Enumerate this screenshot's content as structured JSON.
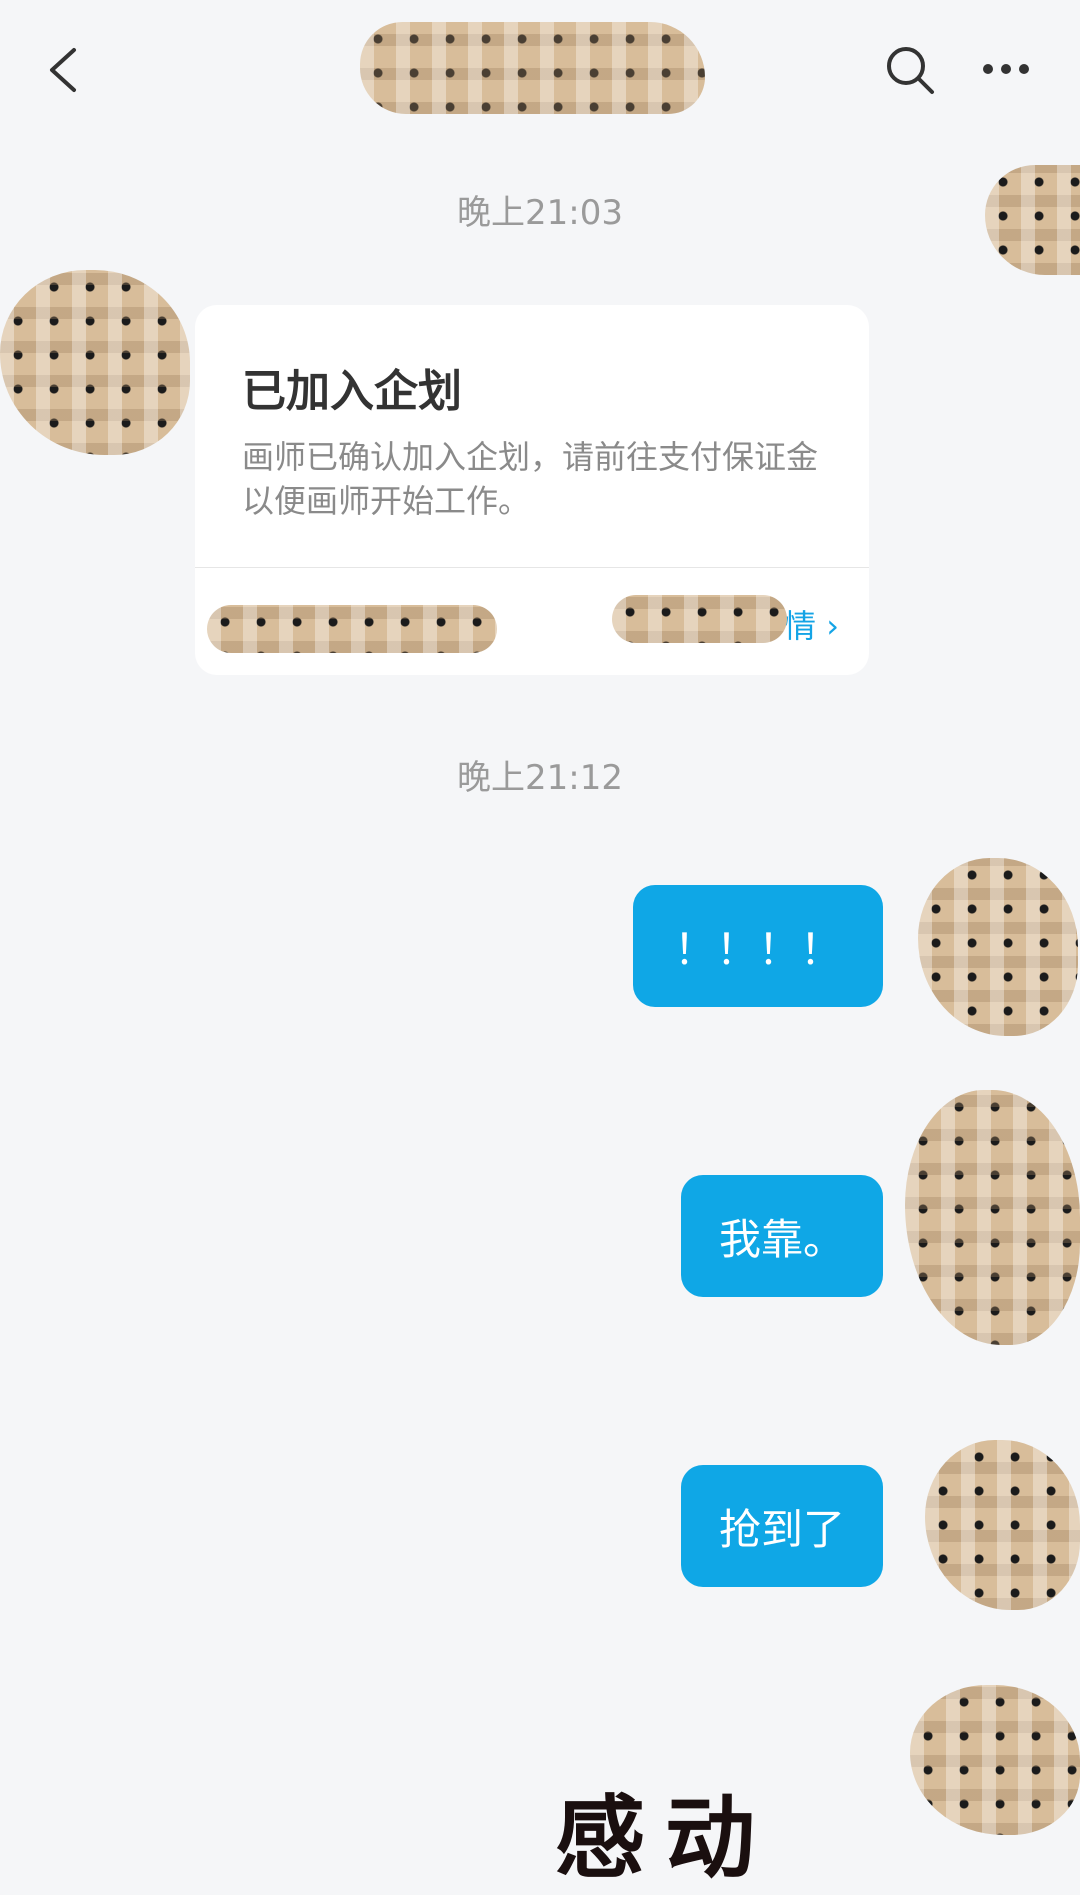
{
  "header": {
    "back_icon": "chevron-left-icon",
    "search_icon": "search-icon",
    "more_icon": "more-horizontal-icon"
  },
  "messages": {
    "time1": "晚上21:03",
    "card": {
      "title": "已加入企划",
      "description": "画师已确认加入企划，请前往支付保证金以便画师开始工作。",
      "link_label": "详情 ›"
    },
    "time2": "晚上21:12",
    "bubble1": "！！！！",
    "bubble2": "我靠。",
    "bubble3": "抢到了",
    "sticker_text": "感动"
  },
  "colors": {
    "bubble": "#0fa7e6",
    "link": "#14a4e6",
    "background": "#f5f6f8"
  }
}
